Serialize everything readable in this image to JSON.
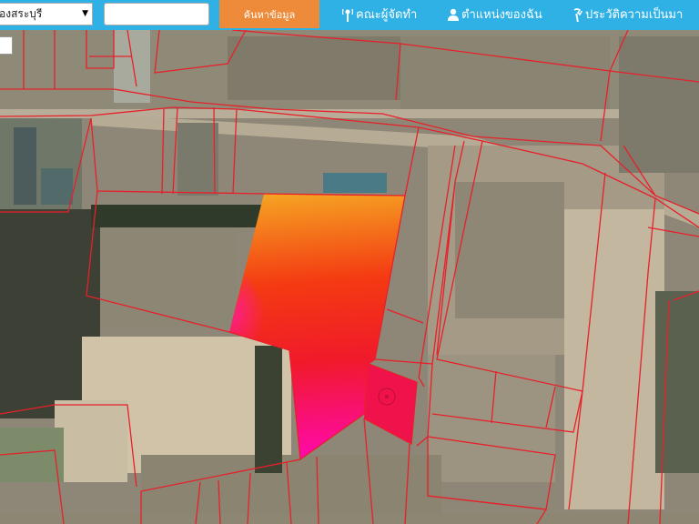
{
  "toolbar": {
    "province_select": "องสระบุรี",
    "search_input_value": "",
    "search_button": "ค้นหาข้อมูล",
    "nav": [
      {
        "label": "คณะผู้จัดทำ",
        "icon": "antenna-icon"
      },
      {
        "label": "ตำแหน่งของฉัน",
        "icon": "person-icon"
      },
      {
        "label": "ประวัติความเป็นมา",
        "icon": "wrench-icon"
      }
    ]
  },
  "colors": {
    "toolbar": "#2fb1e6",
    "search_button": "#ee8b3a",
    "parcel_lines": "#e8202a",
    "heat_top": "#f5a623",
    "heat_mid": "#f01a1a",
    "heat_bottom": "#ff0aa0"
  },
  "map": {
    "basemap": "satellite",
    "overlay": "land-parcel boundaries",
    "highlight": "heatmap-shaded parcel"
  }
}
